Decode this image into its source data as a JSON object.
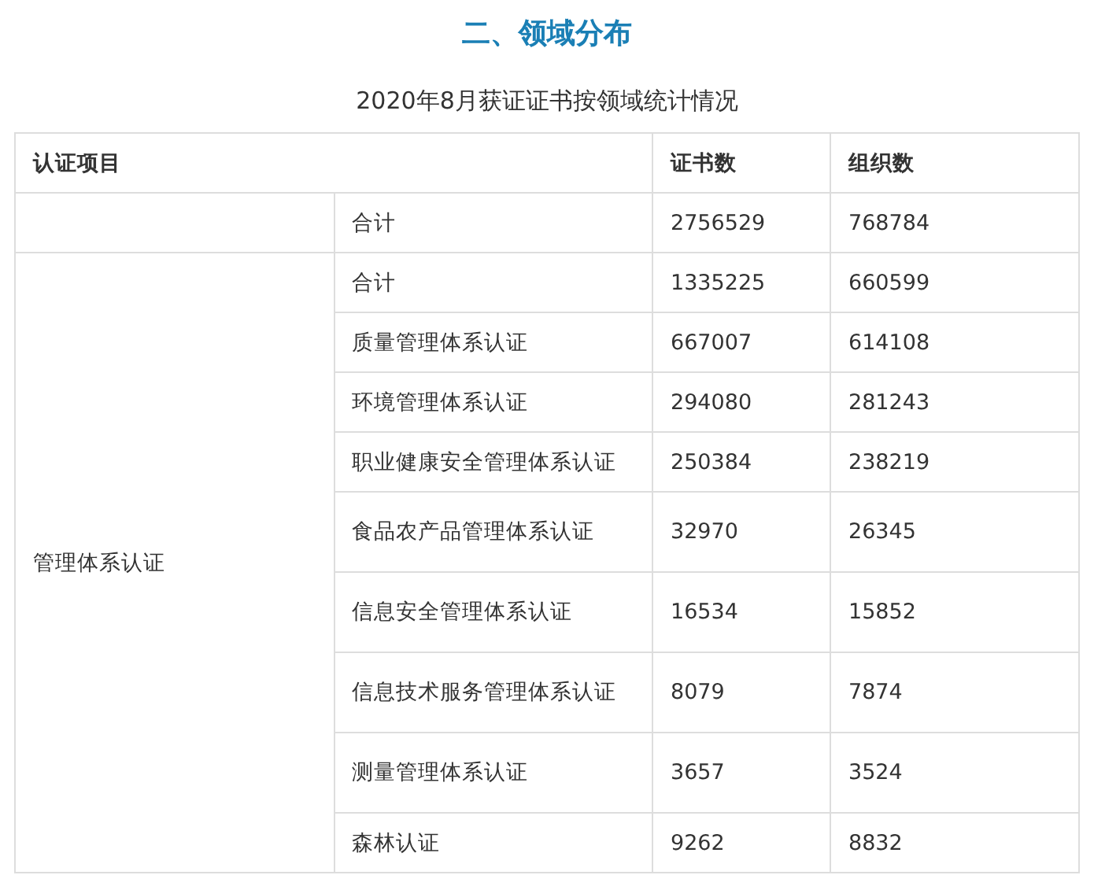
{
  "heading": "二、领域分布",
  "subtitle": "2020年8月获证证书按领域统计情况",
  "table": {
    "columns": [
      "认证项目",
      "证书数",
      "组织数"
    ],
    "groups": [
      {
        "rows": [
          {
            "item": "合计",
            "certificates": "2756529",
            "organizations": "768784"
          }
        ]
      },
      {
        "label": "管理体系认证",
        "rows": [
          {
            "item": "合计",
            "certificates": "1335225",
            "organizations": "660599"
          },
          {
            "item": "质量管理体系认证",
            "certificates": "667007",
            "organizations": "614108"
          },
          {
            "item": "环境管理体系认证",
            "certificates": "294080",
            "organizations": "281243"
          },
          {
            "item": "职业健康安全管理体系认证",
            "certificates": "250384",
            "organizations": "238219"
          },
          {
            "item": "食品农产品管理体系认证",
            "certificates": "32970",
            "organizations": "26345"
          },
          {
            "item": "信息安全管理体系认证",
            "certificates": "16534",
            "organizations": "15852"
          },
          {
            "item": "信息技术服务管理体系认证",
            "certificates": "8079",
            "organizations": "7874"
          },
          {
            "item": "测量管理体系认证",
            "certificates": "3657",
            "organizations": "3524"
          },
          {
            "item": "森林认证",
            "certificates": "9262",
            "organizations": "8832"
          }
        ]
      }
    ]
  }
}
